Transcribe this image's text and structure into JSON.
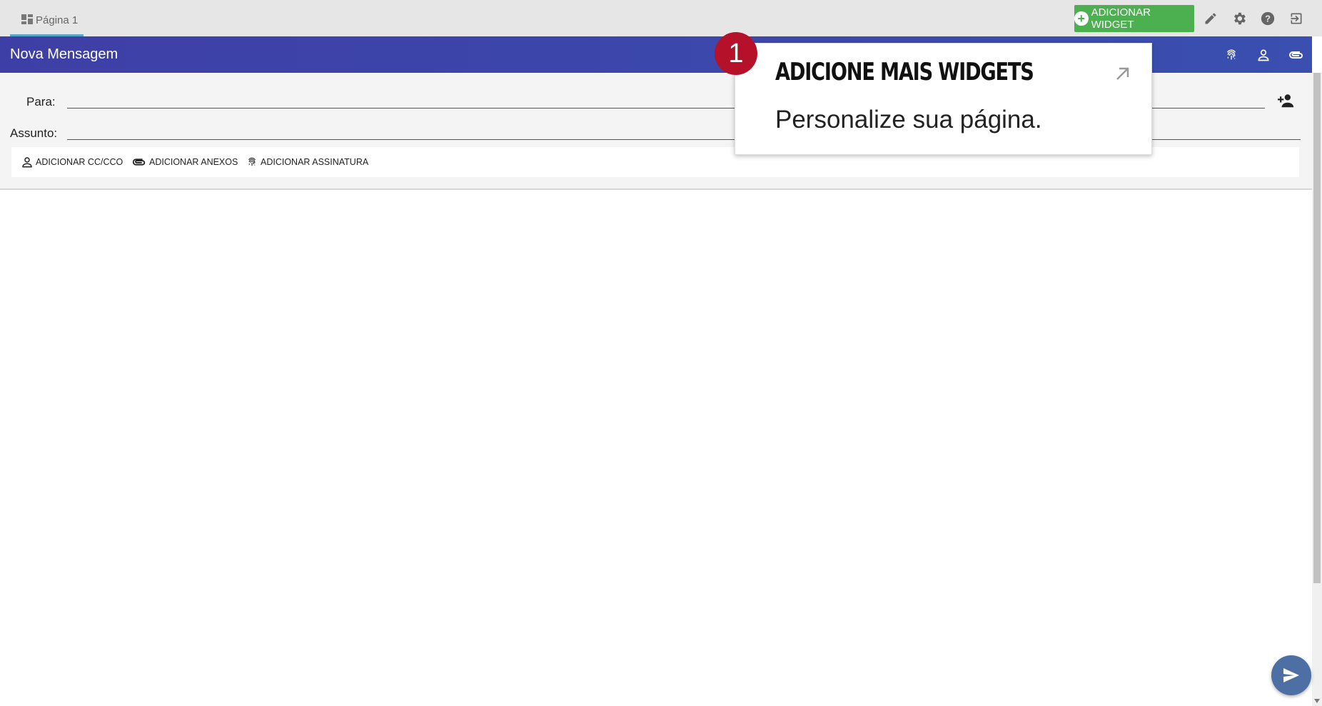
{
  "tab": {
    "label": "Página 1"
  },
  "top_actions": {
    "add_widget_label": "ADICIONAR WIDGET",
    "icons": [
      "pencil-icon",
      "gear-icon",
      "help-icon",
      "logout-icon"
    ]
  },
  "header": {
    "title": "Nova Mensagem",
    "icons": [
      "fingerprint-icon",
      "person-icon",
      "attachment-icon"
    ]
  },
  "compose": {
    "to_label": "Para:",
    "subject_label": "Assunto:",
    "to_value": "",
    "subject_value": "",
    "add_recipient_icon": "person-add-icon"
  },
  "toolbar": {
    "cc_label": "ADICIONAR CC/CCO",
    "attach_label": "ADICIONAR ANEXOS",
    "signature_label": "ADICIONAR ASSINATURA"
  },
  "tour": {
    "step": "1",
    "title": "ADICIONE MAIS WIDGETS",
    "text": "Personalize sua página."
  },
  "colors": {
    "header": "#3e3fa6",
    "add_widget": "#4caf50",
    "badge": "#b5112a",
    "fab": "#4d6fa3"
  }
}
